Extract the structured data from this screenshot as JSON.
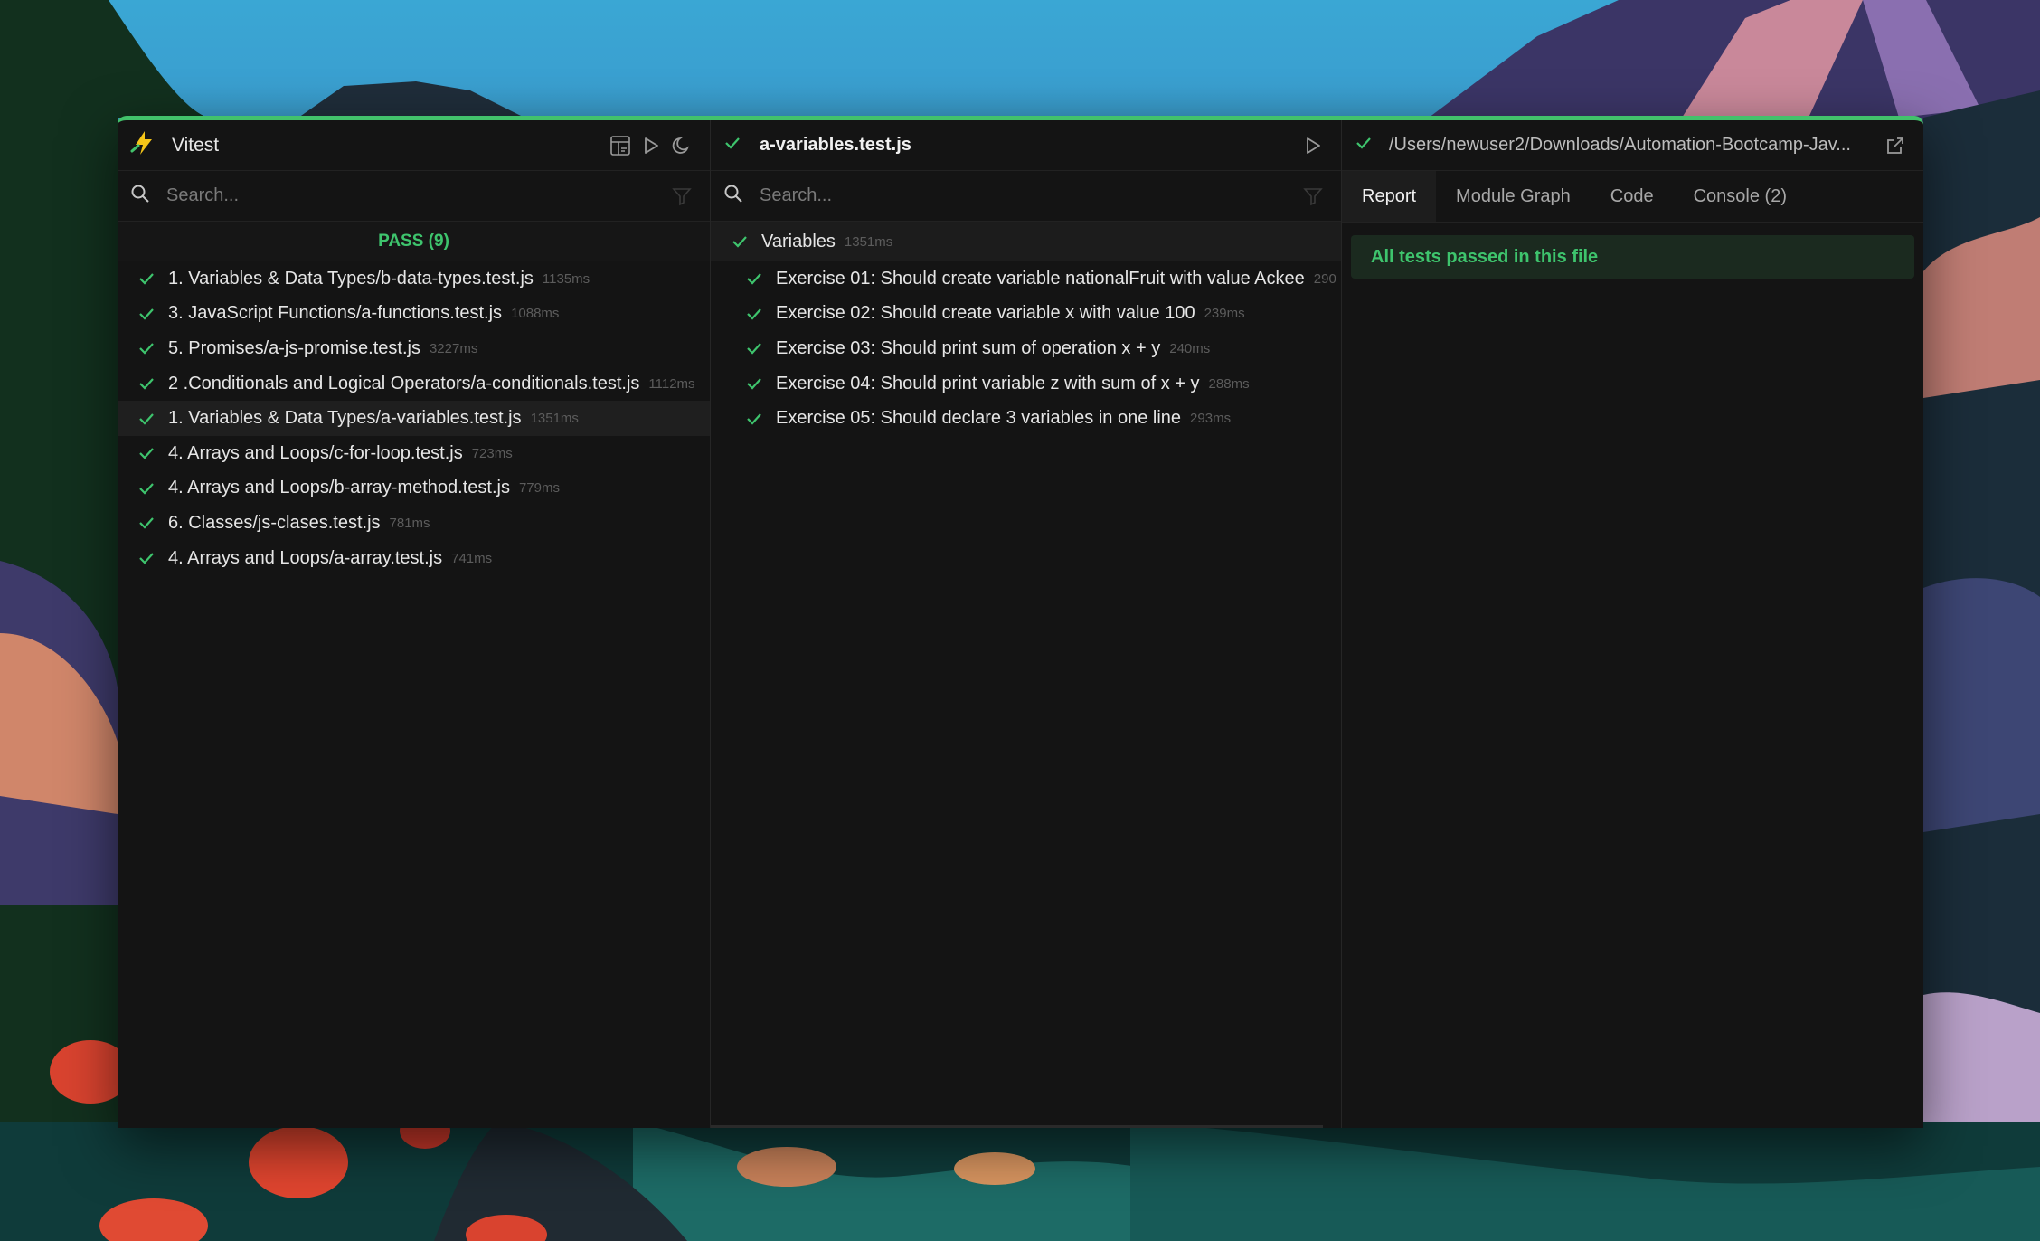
{
  "app": {
    "title": "Vitest",
    "accent": "#42c26b"
  },
  "left_pane": {
    "search": {
      "placeholder": "Search..."
    },
    "pass_header": "PASS (9)",
    "files": [
      {
        "name": "1. Variables & Data Types/b-data-types.test.js",
        "duration": "1135ms",
        "selected": false
      },
      {
        "name": "3. JavaScript Functions/a-functions.test.js",
        "duration": "1088ms",
        "selected": false
      },
      {
        "name": "5. Promises/a-js-promise.test.js",
        "duration": "3227ms",
        "selected": false
      },
      {
        "name": "2 .Conditionals and Logical Operators/a-conditionals.test.js",
        "duration": "1112ms",
        "selected": false
      },
      {
        "name": "1. Variables & Data Types/a-variables.test.js",
        "duration": "1351ms",
        "selected": true
      },
      {
        "name": "4. Arrays and Loops/c-for-loop.test.js",
        "duration": "723ms",
        "selected": false
      },
      {
        "name": "4. Arrays and Loops/b-array-method.test.js",
        "duration": "779ms",
        "selected": false
      },
      {
        "name": "6. Classes/js-clases.test.js",
        "duration": "781ms",
        "selected": false
      },
      {
        "name": "4. Arrays and Loops/a-array.test.js",
        "duration": "741ms",
        "selected": false
      }
    ]
  },
  "middle_pane": {
    "file_title": "a-variables.test.js",
    "search": {
      "placeholder": "Search..."
    },
    "suite": {
      "name": "Variables",
      "duration": "1351ms"
    },
    "tests": [
      {
        "name": "Exercise 01: Should create variable nationalFruit with value Ackee",
        "duration": "290"
      },
      {
        "name": "Exercise 02: Should create variable x with value 100",
        "duration": "239ms"
      },
      {
        "name": "Exercise 03: Should print sum of operation x + y",
        "duration": "240ms"
      },
      {
        "name": "Exercise 04: Should print variable z with sum of x + y",
        "duration": "288ms"
      },
      {
        "name": "Exercise 05: Should declare 3 variables in one line",
        "duration": "293ms"
      }
    ]
  },
  "right_pane": {
    "path": "/Users/newuser2/Downloads/Automation-Bootcamp-Jav...",
    "tabs": [
      "Report",
      "Module Graph",
      "Code",
      "Console (2)"
    ],
    "active_tab": "Report",
    "report_message": "All tests passed in this file"
  },
  "icons": {
    "logo": "vitest-bolt-icon",
    "dashboard": "dashboard-icon",
    "run": "play-icon",
    "theme": "moon-icon",
    "search": "search-icon",
    "filter": "filter-icon",
    "status": "check-icon",
    "external": "open-external-icon"
  }
}
